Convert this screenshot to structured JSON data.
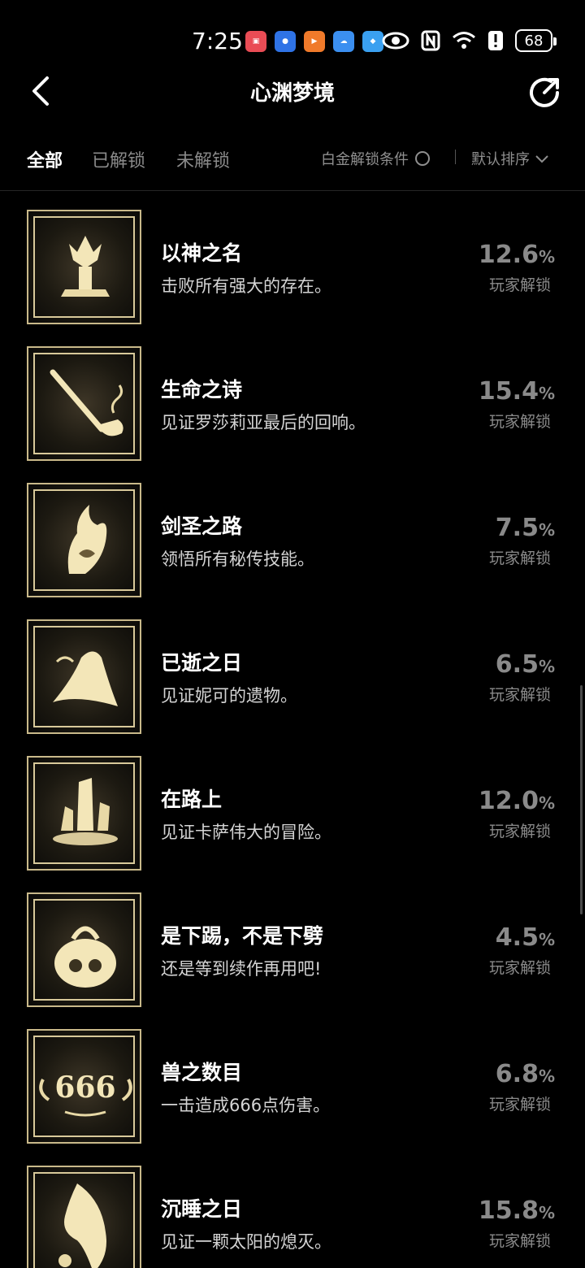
{
  "status_bar": {
    "time": "7:25",
    "battery": "68",
    "app_icons": [
      {
        "name": "huawei-mall-icon",
        "color": "#e94c55"
      },
      {
        "name": "app-blue-icon",
        "color": "#2f73e6"
      },
      {
        "name": "video-orange-icon",
        "color": "#f07a2a"
      },
      {
        "name": "weather-icon",
        "color": "#3b8ff0"
      },
      {
        "name": "app-bird-icon",
        "color": "#3aa0f0"
      }
    ]
  },
  "nav": {
    "title": "心渊梦境"
  },
  "tabs": {
    "all": "全部",
    "unlocked": "已解锁",
    "locked": "未解锁",
    "platinum_condition": "白金解锁条件",
    "sort": "默认排序"
  },
  "achievements": [
    {
      "name": "以神之名",
      "desc": "击败所有强大的存在。",
      "percent": "12.6",
      "unit": "%",
      "label": "玩家解锁",
      "icon": "tree-hands-icon"
    },
    {
      "name": "生命之诗",
      "desc": "见证罗莎莉亚最后的回响。",
      "percent": "15.4",
      "unit": "%",
      "label": "玩家解锁",
      "icon": "pipe-icon"
    },
    {
      "name": "剑圣之路",
      "desc": "领悟所有秘传技能。",
      "percent": "7.5",
      "unit": "%",
      "label": "玩家解锁",
      "icon": "flame-hand-icon"
    },
    {
      "name": "已逝之日",
      "desc": "见证妮可的遗物。",
      "percent": "6.5",
      "unit": "%",
      "label": "玩家解锁",
      "icon": "witch-hat-icon"
    },
    {
      "name": "在路上",
      "desc": "见证卡萨伟大的冒险。",
      "percent": "12.0",
      "unit": "%",
      "label": "玩家解锁",
      "icon": "crystal-icon"
    },
    {
      "name": "是下踢，不是下劈",
      "desc": "还是等到续作再用吧!",
      "percent": "4.5",
      "unit": "%",
      "label": "玩家解锁",
      "icon": "skull-bag-icon"
    },
    {
      "name": "兽之数目",
      "desc": "一击造成666点伤害。",
      "percent": "6.8",
      "unit": "%",
      "label": "玩家解锁",
      "icon": "number-666-icon",
      "badge_text": "666"
    },
    {
      "name": "沉睡之日",
      "desc": "见证一颗太阳的熄灭。",
      "percent": "15.8",
      "unit": "%",
      "label": "玩家解锁",
      "icon": "phoenix-icon"
    }
  ]
}
